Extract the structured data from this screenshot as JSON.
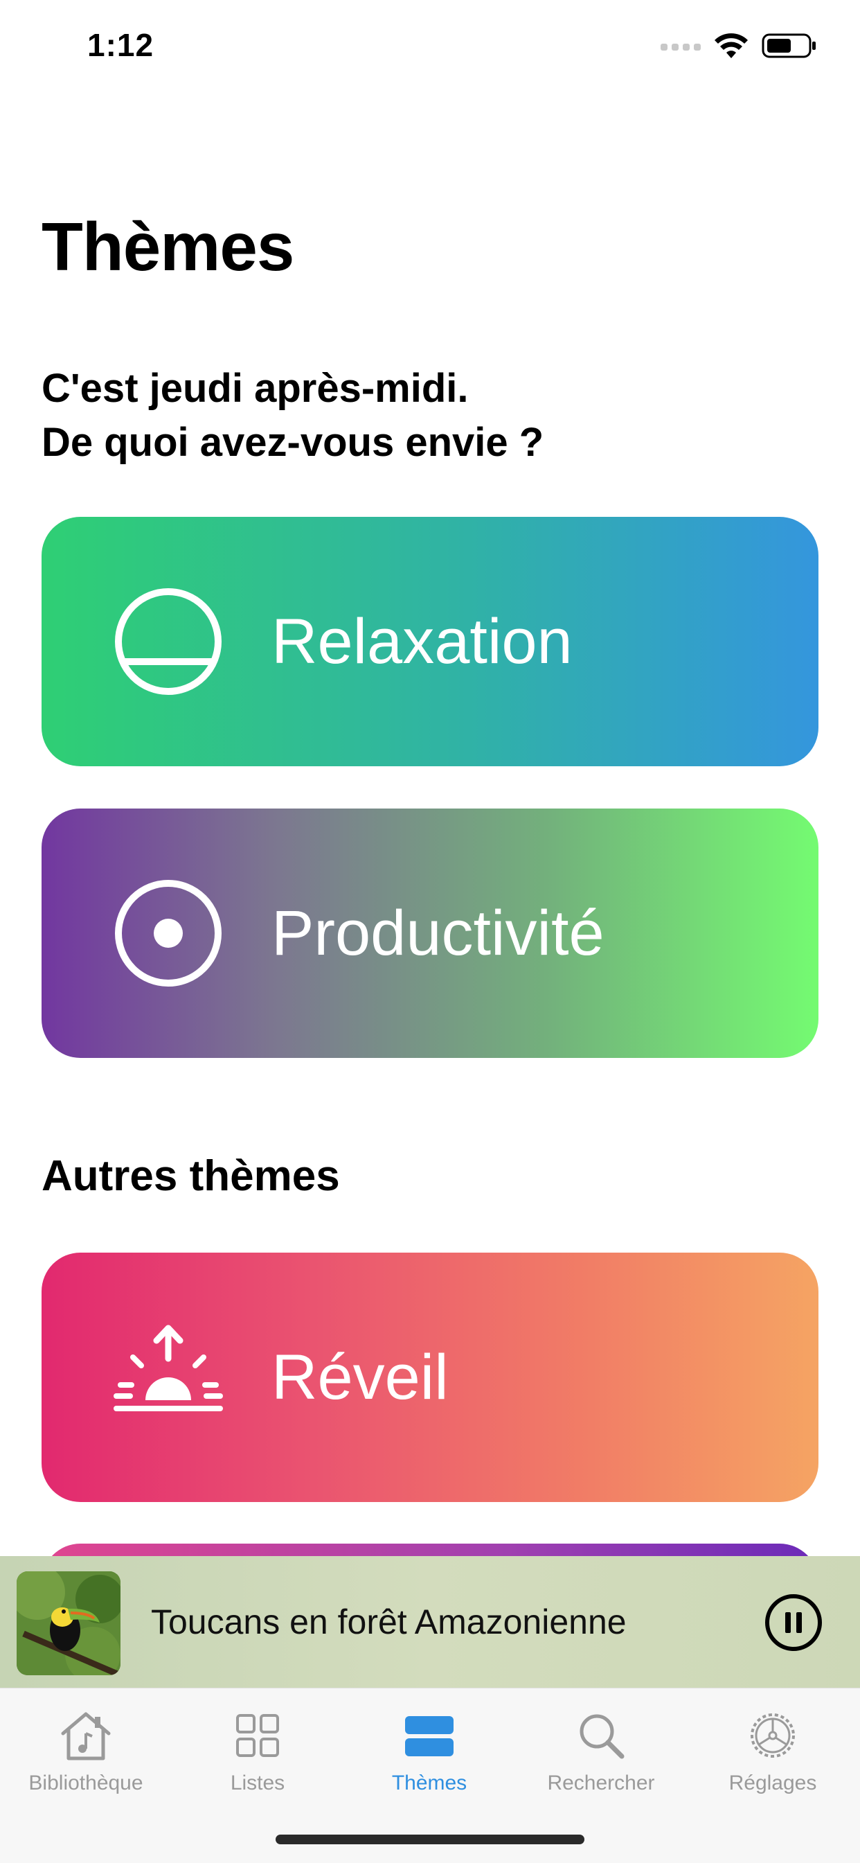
{
  "status_bar": {
    "time": "1:12"
  },
  "header": {
    "title": "Thèmes"
  },
  "greeting": {
    "line1": "C'est jeudi après-midi.",
    "line2": "De quoi avez-vous envie ?"
  },
  "featured_themes": [
    {
      "label": "Relaxation",
      "icon": "half-circle-icon"
    },
    {
      "label": "Productivité",
      "icon": "target-dot-icon"
    }
  ],
  "other_section": {
    "title": "Autres thèmes"
  },
  "other_themes": [
    {
      "label": "Réveil",
      "icon": "sunrise-icon"
    }
  ],
  "now_playing": {
    "title": "Toucans en forêt Amazonienne",
    "state": "playing"
  },
  "tabs": [
    {
      "label": "Bibliothèque",
      "icon": "library-house-icon",
      "active": false
    },
    {
      "label": "Listes",
      "icon": "grid-icon",
      "active": false
    },
    {
      "label": "Thèmes",
      "icon": "themes-icon",
      "active": true
    },
    {
      "label": "Rechercher",
      "icon": "search-icon",
      "active": false
    },
    {
      "label": "Réglages",
      "icon": "gear-icon",
      "active": false
    }
  ],
  "colors": {
    "accent": "#2f8fe0",
    "tab_inactive": "#9a9a9a"
  }
}
